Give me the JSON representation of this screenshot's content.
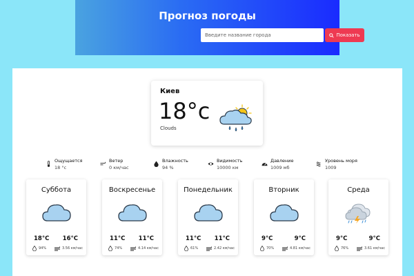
{
  "header": {
    "title": "Прогноз погоды",
    "search_placeholder": "Введите название города",
    "search_button": "Показать"
  },
  "current": {
    "city": "Киев",
    "temperature": "18°c",
    "condition": "Clouds",
    "icon": "cloud-sun-rain-icon"
  },
  "details": [
    {
      "label": "Ощущается",
      "value": "18 °c",
      "icon": "thermometer-icon"
    },
    {
      "label": "Ветер",
      "value": "0 км/час",
      "icon": "wind-icon"
    },
    {
      "label": "Влажность",
      "value": "94 %",
      "icon": "droplet-icon"
    },
    {
      "label": "Видимость",
      "value": "10000 км",
      "icon": "eye-icon"
    },
    {
      "label": "Давление",
      "value": "1009 мб",
      "icon": "gauge-icon"
    },
    {
      "label": "Уровень моря",
      "value": "1009",
      "icon": "waves-icon"
    }
  ],
  "forecast": [
    {
      "day": "Суббота",
      "min": "18°C",
      "max": "16°C",
      "humidity": "94%",
      "wind": "3.56 км/час",
      "icon": "cloud-icon"
    },
    {
      "day": "Воскресенье",
      "min": "11°C",
      "max": "11°C",
      "humidity": "74%",
      "wind": "4.14 км/час",
      "icon": "cloud-icon"
    },
    {
      "day": "Понедельник",
      "min": "11°C",
      "max": "11°C",
      "humidity": "61%",
      "wind": "2.42 км/час",
      "icon": "cloud-icon"
    },
    {
      "day": "Вторник",
      "min": "9°C",
      "max": "9°C",
      "humidity": "70%",
      "wind": "4.81 км/час",
      "icon": "cloud-icon"
    },
    {
      "day": "Среда",
      "min": "9°C",
      "max": "9°C",
      "humidity": "76%",
      "wind": "3.61 км/час",
      "icon": "thunderstorm-icon"
    }
  ],
  "colors": {
    "background": "#8be6f9",
    "header_gradient_start": "#4aa3e0",
    "header_gradient_end": "#1a2bff",
    "button": "#ee3a52",
    "cloud_fill": "#a8d2f0",
    "cloud_stroke": "#2b3a4a",
    "sun": "#f5c518",
    "rain": "#3a8fd8"
  }
}
